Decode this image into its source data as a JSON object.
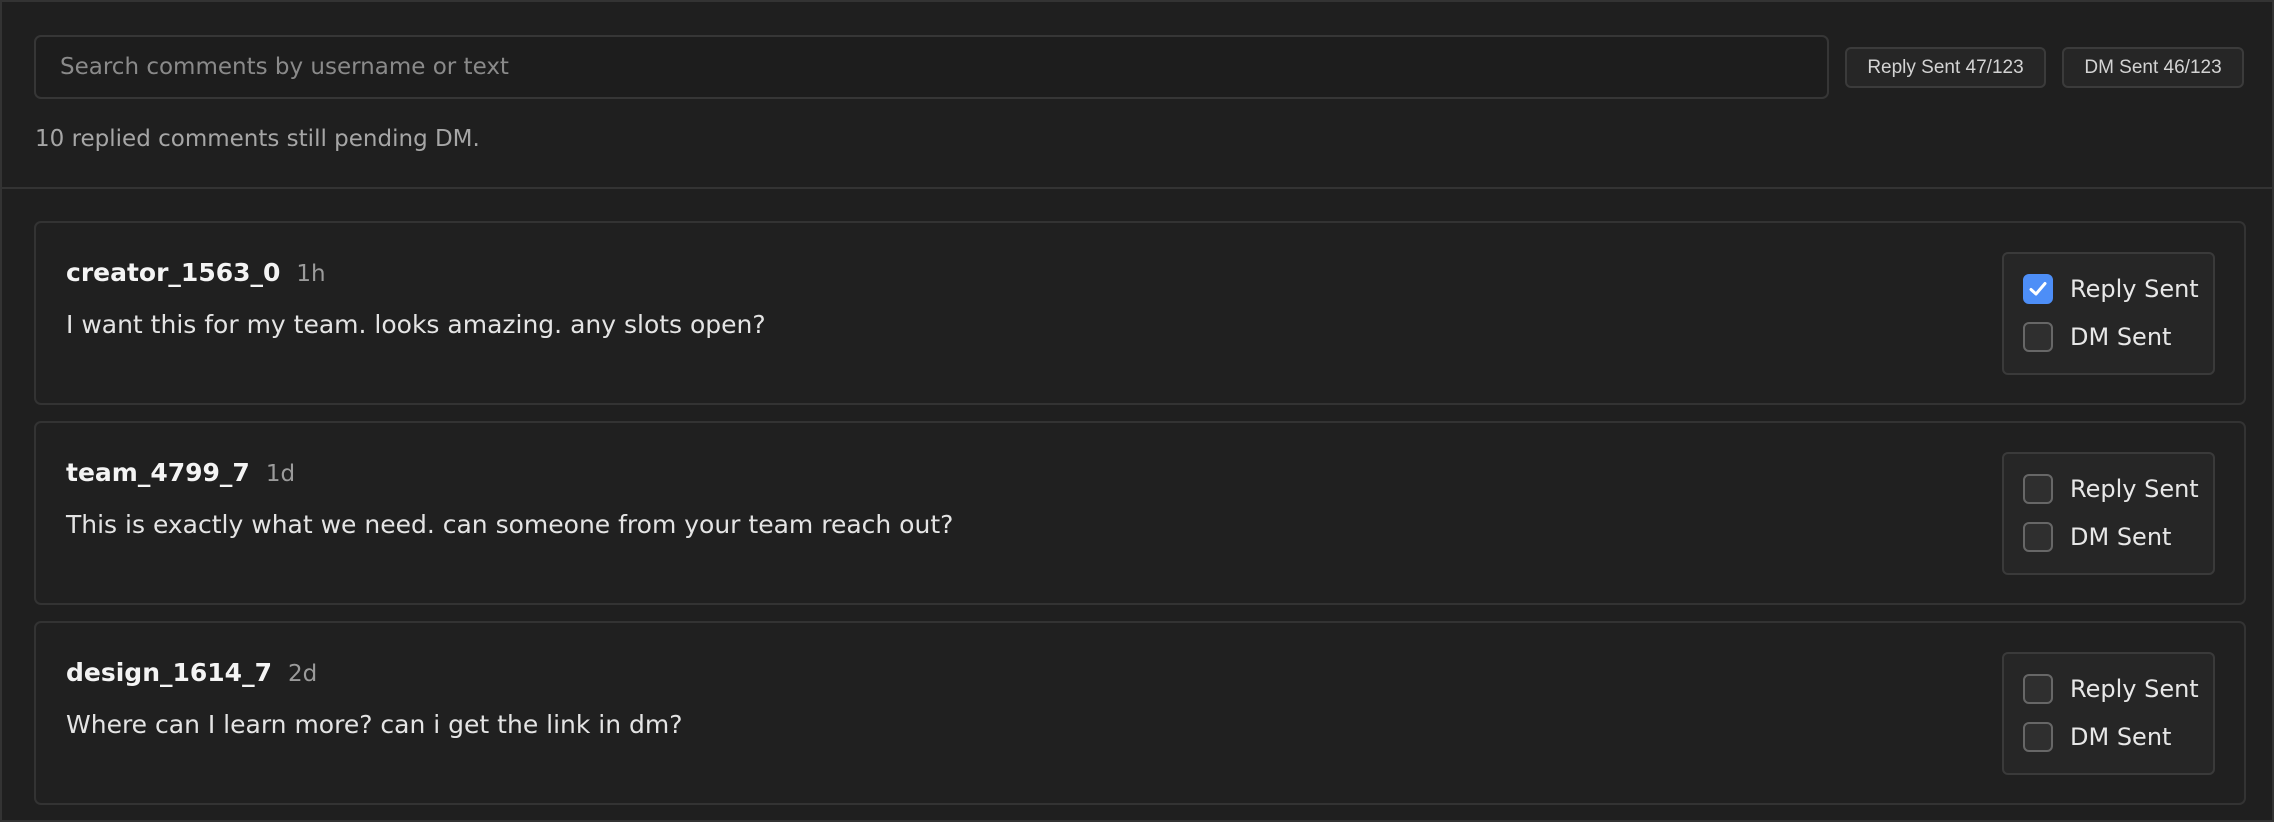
{
  "header": {
    "search_placeholder": "Search comments by username or text",
    "search_value": "",
    "reply_sent_summary": "Reply Sent 47/123",
    "dm_sent_summary": "DM Sent 46/123",
    "pending_message": "10 replied comments still pending DM."
  },
  "comments": [
    {
      "username": "creator_1563_0",
      "time": "1h",
      "text": "I want this for my team. looks amazing. any slots open?",
      "reply_sent": true,
      "dm_sent": false,
      "reply_label": "Reply Sent",
      "dm_label": "DM Sent"
    },
    {
      "username": "team_4799_7",
      "time": "1d",
      "text": "This is exactly what we need. can someone from your team reach out?",
      "reply_sent": false,
      "dm_sent": false,
      "reply_label": "Reply Sent",
      "dm_label": "DM Sent"
    },
    {
      "username": "design_1614_7",
      "time": "2d",
      "text": "Where can I learn more? can i get the link in dm?",
      "reply_sent": false,
      "dm_sent": false,
      "reply_label": "Reply Sent",
      "dm_label": "DM Sent"
    }
  ],
  "colors": {
    "accent": "#4d8ef7",
    "background": "#1f1f1f",
    "border": "#333333"
  },
  "icons": {
    "check": "check-icon"
  }
}
